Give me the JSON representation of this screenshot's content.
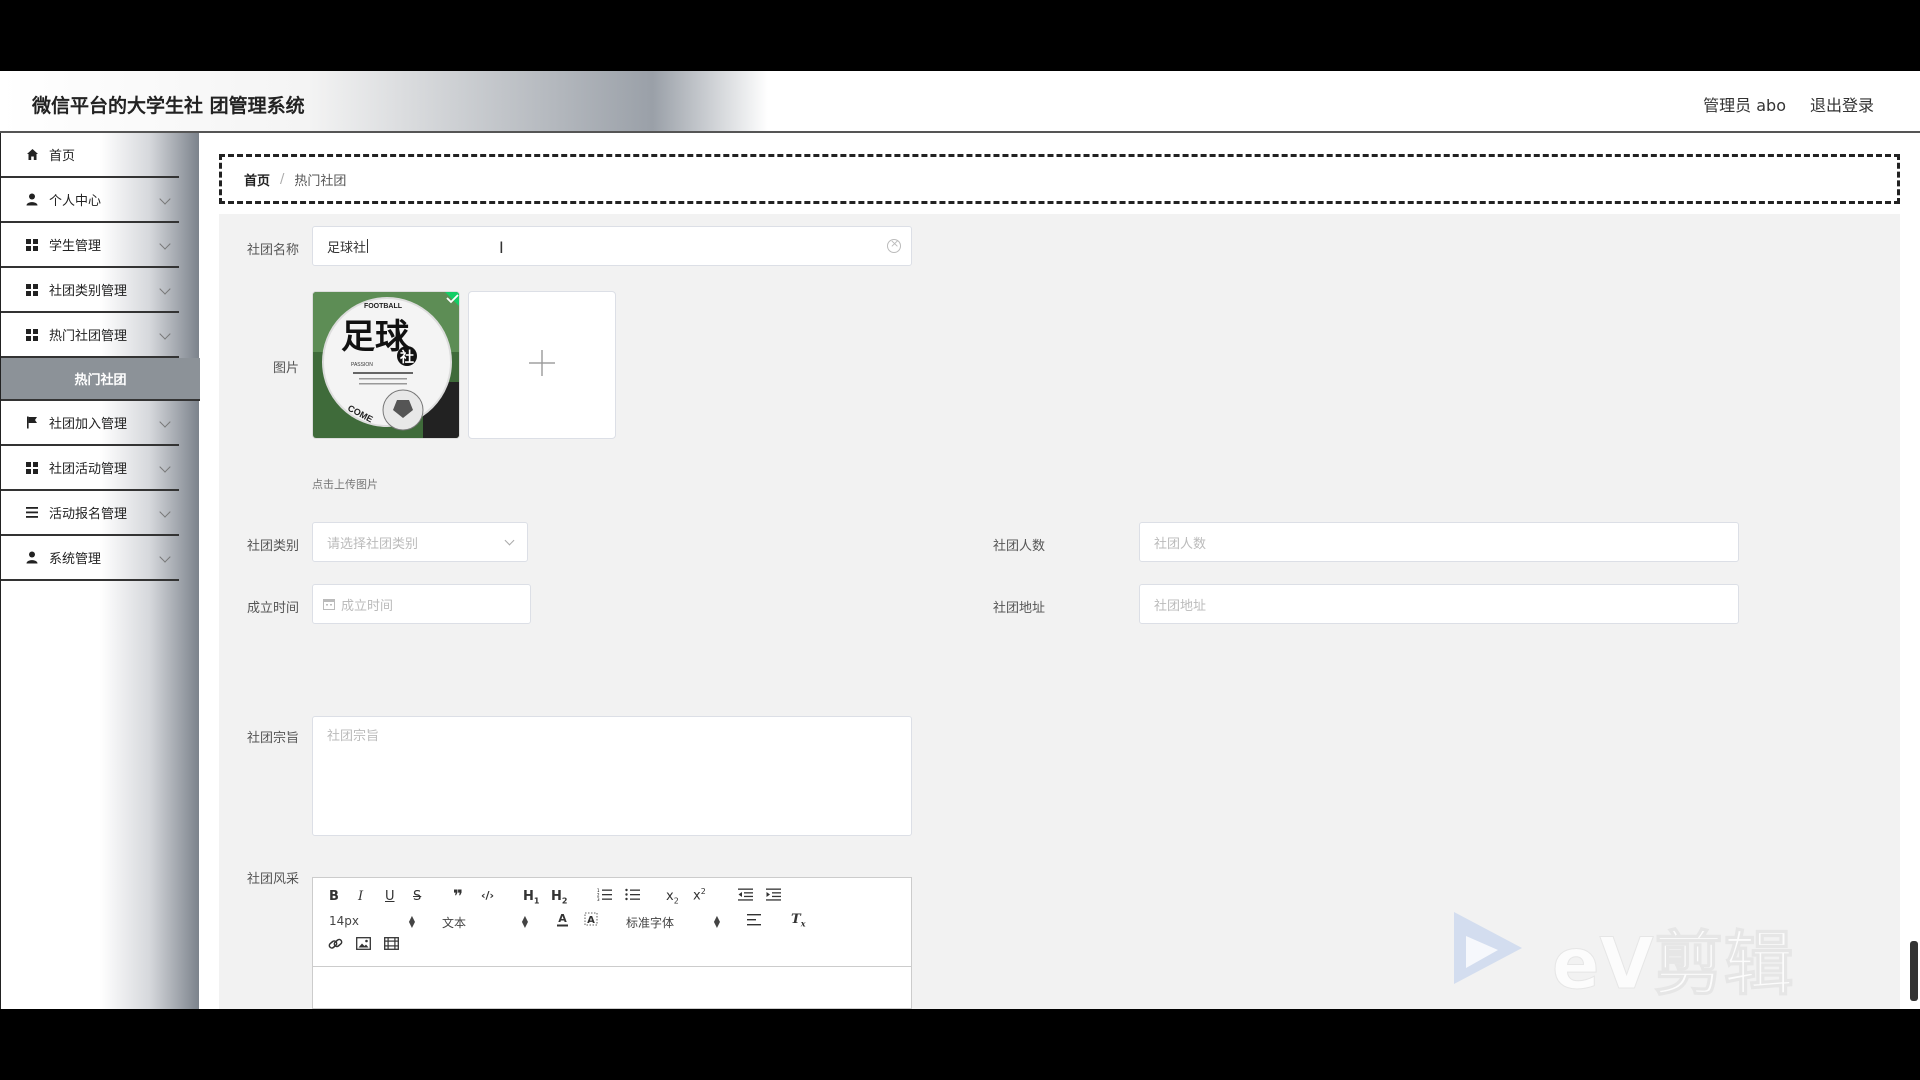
{
  "header": {
    "title": "微信平台的大学生社 团管理系统",
    "admin": "管理员 abo",
    "logout": "退出登录"
  },
  "sidebar": {
    "items": [
      {
        "label": "首页"
      },
      {
        "label": "个人中心"
      },
      {
        "label": "学生管理"
      },
      {
        "label": "社团类别管理"
      },
      {
        "label": "热门社团管理"
      },
      {
        "label": "热门社团"
      },
      {
        "label": "社团加入管理"
      },
      {
        "label": "社团活动管理"
      },
      {
        "label": "活动报名管理"
      },
      {
        "label": "系统管理"
      }
    ]
  },
  "breadcrumb": {
    "home": "首页",
    "separator": "/",
    "current": "热门社团"
  },
  "form": {
    "name_label": "社团名称",
    "name_value": "足球社",
    "image_label": "图片",
    "upload_hint": "点击上传图片",
    "category_label": "社团类别",
    "category_placeholder": "请选择社团类别",
    "members_label": "社团人数",
    "members_placeholder": "社团人数",
    "founded_label": "成立时间",
    "founded_placeholder": "成立时间",
    "address_label": "社团地址",
    "address_placeholder": "社团地址",
    "purpose_label": "社团宗旨",
    "purpose_placeholder": "社团宗旨",
    "style_label": "社团风采"
  },
  "thumbnail": {
    "top_text": "FOOTBALL",
    "big_text": "足球",
    "small_text": "社",
    "passion": "PASSION",
    "come": "COME"
  },
  "editor": {
    "font_size": "14px",
    "text_style": "文本",
    "font_family": "标准字体"
  },
  "watermark": {
    "text": "eV剪辑"
  },
  "colors": {
    "accent_green": "#13ce66",
    "sidebar_active": "#8c9298"
  }
}
